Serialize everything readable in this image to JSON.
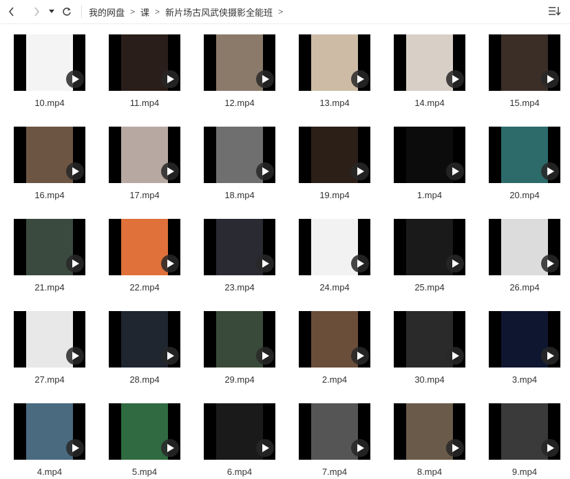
{
  "breadcrumb": [
    "我的网盘",
    "课",
    "新片场古风武侠摄影全能班"
  ],
  "icons": {
    "back": "chevron-left-icon",
    "forward": "chevron-right-icon",
    "history": "caret-down-icon",
    "refresh": "refresh-icon",
    "sort": "sort-list-icon",
    "play": "play-icon"
  },
  "files": [
    {
      "name": "10.mp4",
      "bg": "#f4f4f4"
    },
    {
      "name": "11.mp4",
      "bg": "#2a1e1a"
    },
    {
      "name": "12.mp4",
      "bg": "#8b7a6a"
    },
    {
      "name": "13.mp4",
      "bg": "#cdbba6"
    },
    {
      "name": "14.mp4",
      "bg": "#d8cfc7"
    },
    {
      "name": "15.mp4",
      "bg": "#3a2e26"
    },
    {
      "name": "16.mp4",
      "bg": "#6d5543"
    },
    {
      "name": "17.mp4",
      "bg": "#b7a9a2"
    },
    {
      "name": "18.mp4",
      "bg": "#6f6f6f"
    },
    {
      "name": "19.mp4",
      "bg": "#2b1f18"
    },
    {
      "name": "1.mp4",
      "bg": "#0c0c0c"
    },
    {
      "name": "20.mp4",
      "bg": "#2d6b6a"
    },
    {
      "name": "21.mp4",
      "bg": "#3a4a3f"
    },
    {
      "name": "22.mp4",
      "bg": "#e0713a"
    },
    {
      "name": "23.mp4",
      "bg": "#2a2a33"
    },
    {
      "name": "24.mp4",
      "bg": "#f2f2f2"
    },
    {
      "name": "25.mp4",
      "bg": "#1a1a1a"
    },
    {
      "name": "26.mp4",
      "bg": "#dcdcdc"
    },
    {
      "name": "27.mp4",
      "bg": "#e8e8e8"
    },
    {
      "name": "28.mp4",
      "bg": "#1f2630"
    },
    {
      "name": "29.mp4",
      "bg": "#3a4a3a"
    },
    {
      "name": "2.mp4",
      "bg": "#6a4e3a"
    },
    {
      "name": "30.mp4",
      "bg": "#2a2a2a"
    },
    {
      "name": "3.mp4",
      "bg": "#0f1630"
    },
    {
      "name": "4.mp4",
      "bg": "#4a6a80"
    },
    {
      "name": "5.mp4",
      "bg": "#2f6a40"
    },
    {
      "name": "6.mp4",
      "bg": "#1a1a1a"
    },
    {
      "name": "7.mp4",
      "bg": "#555555"
    },
    {
      "name": "8.mp4",
      "bg": "#6a5a4a"
    },
    {
      "name": "9.mp4",
      "bg": "#3a3a3a"
    }
  ]
}
